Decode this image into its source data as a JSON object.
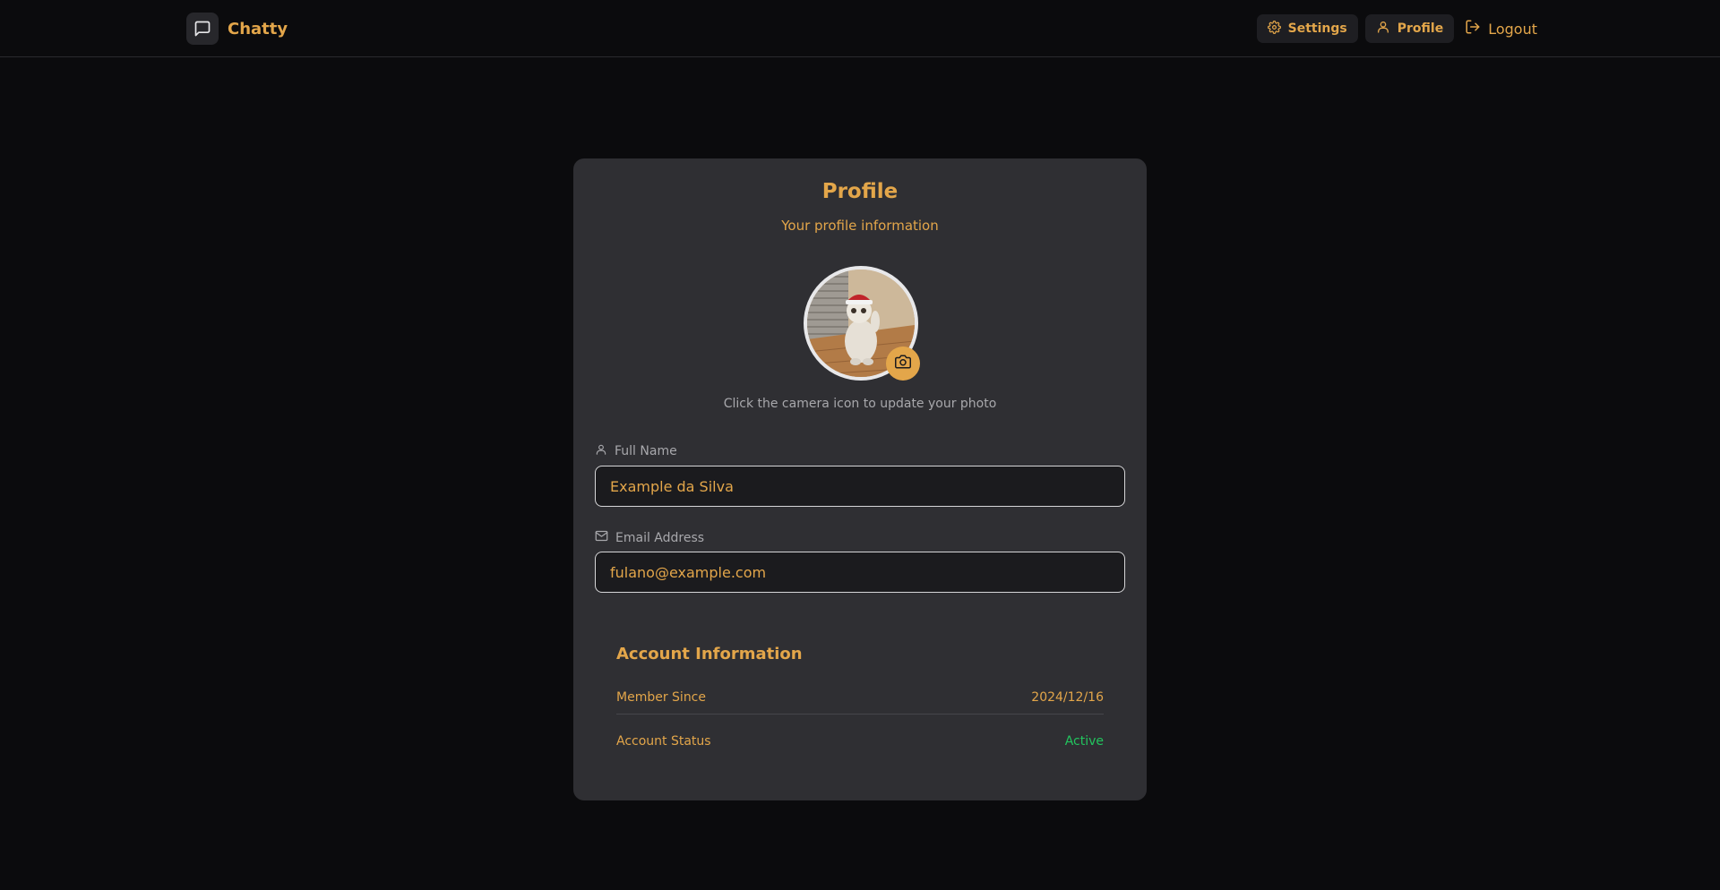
{
  "nav": {
    "brand": "Chatty",
    "settings_label": "Settings",
    "profile_label": "Profile",
    "logout_label": "Logout"
  },
  "profile": {
    "title": "Profile",
    "subtitle": "Your profile information",
    "photo_hint": "Click the camera icon to update your photo",
    "full_name_label": "Full Name",
    "full_name_value": "Example da Silva",
    "email_label": "Email Address",
    "email_value": "fulano@example.com"
  },
  "account": {
    "title": "Account Information",
    "member_since_label": "Member Since",
    "member_since_value": "2024/12/16",
    "status_label": "Account Status",
    "status_value": "Active"
  },
  "colors": {
    "accent": "#e3a64a",
    "background": "#0b0b0d",
    "card": "#2f2f33",
    "status_active": "#22c55e"
  },
  "icons": {
    "brand": "message-square-icon",
    "settings": "gear-icon",
    "profile": "user-icon",
    "logout": "logout-icon",
    "camera": "camera-icon",
    "full_name": "user-icon",
    "email": "mail-icon"
  }
}
